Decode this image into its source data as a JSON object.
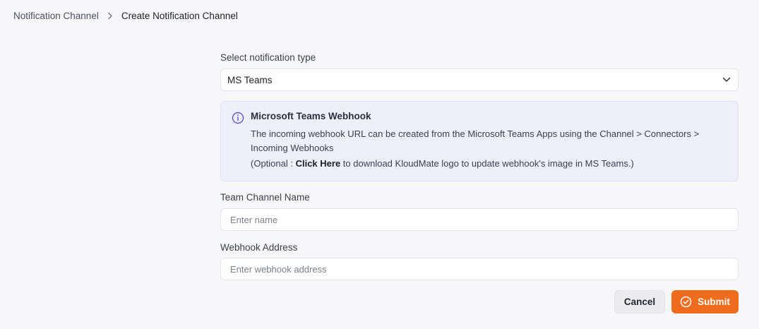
{
  "breadcrumb": {
    "parent": "Notification Channel",
    "current": "Create Notification Channel"
  },
  "form": {
    "type_label": "Select notification type",
    "type_value": "MS Teams",
    "info": {
      "title": "Microsoft Teams Webhook",
      "text": "The incoming webhook URL can be created from the Microsoft Teams Apps using the Channel > Connectors > Incoming Webhooks",
      "optional_prefix": "(Optional : ",
      "click_here": "Click Here",
      "optional_suffix": " to download KloudMate logo to update webhook's image in MS Teams.)"
    },
    "channel_name_label": "Team Channel Name",
    "channel_name_placeholder": "Enter name",
    "webhook_label": "Webhook Address",
    "webhook_placeholder": "Enter webhook address"
  },
  "actions": {
    "cancel_label": "Cancel",
    "submit_label": "Submit"
  },
  "icons": {
    "breadcrumb_separator": "chevron-right-icon",
    "select_caret": "chevron-down-icon",
    "info": "info-circle-icon",
    "submit": "check-circle-icon"
  },
  "colors": {
    "accent": "#ee6c1b",
    "info_background": "#efeffc",
    "info_icon": "#5b5bd6",
    "page_background": "#f7f7f9"
  }
}
